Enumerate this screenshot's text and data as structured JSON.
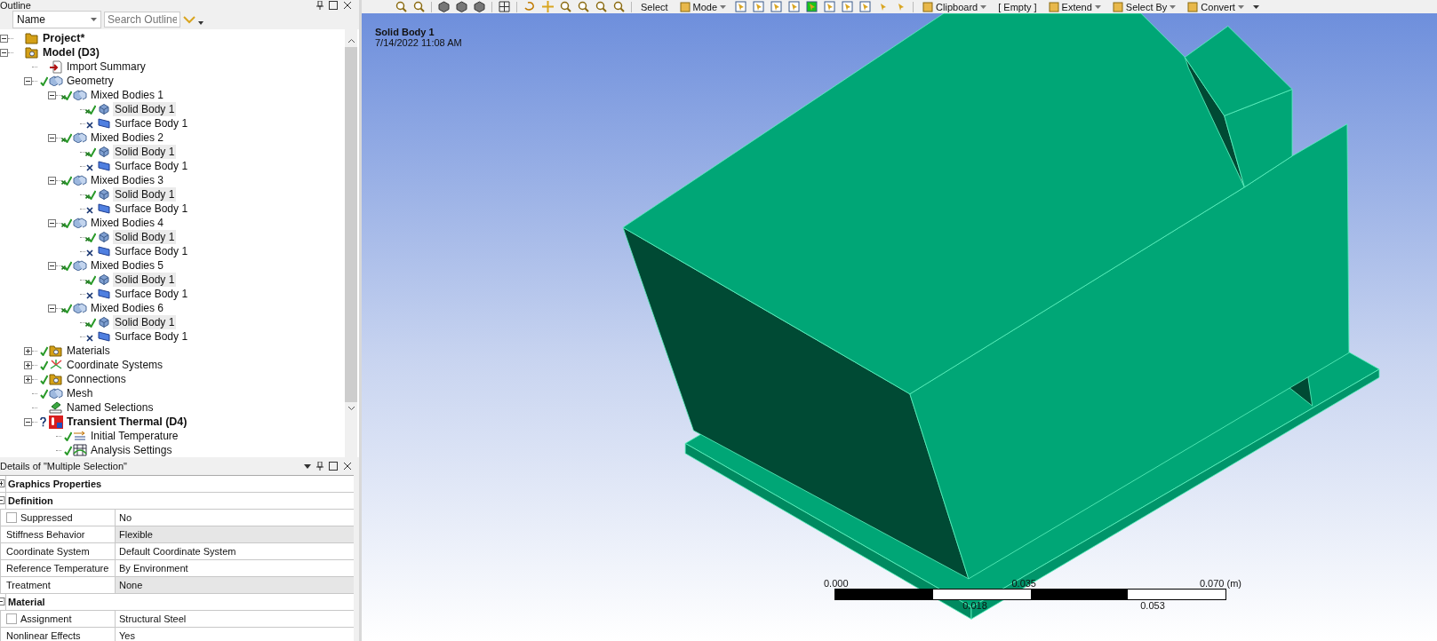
{
  "outline": {
    "title": "Outline",
    "sort_field": "Name",
    "search_placeholder": "Search Outline",
    "tree": [
      {
        "label": "Project*",
        "kind": "project",
        "selected": false,
        "expanded": true,
        "children": [
          {
            "label": "Model (D3)",
            "kind": "model",
            "selected": false,
            "expanded": true,
            "children": [
              {
                "label": "Import Summary",
                "kind": "import",
                "selected": false
              },
              {
                "label": "Geometry",
                "kind": "geometry",
                "selected": false,
                "ok": true,
                "partly_suppressed": false,
                "suppressed": false,
                "undefined": false,
                "expanded": true,
                "children": [
                  {
                    "label": "Mixed Bodies 1",
                    "kind": "bodies",
                    "selected": false,
                    "ok": true,
                    "partly_suppressed": true,
                    "suppressed": false,
                    "undefined": false,
                    "expanded": true,
                    "children": [
                      {
                        "label": "Solid Body 1",
                        "kind": "solid",
                        "selected": true,
                        "ok": true,
                        "partly_suppressed": true,
                        "suppressed": false,
                        "undefined": false
                      },
                      {
                        "label": "Surface Body 1",
                        "kind": "surface",
                        "selected": false,
                        "ok": false,
                        "partly_suppressed": false,
                        "suppressed": true,
                        "undefined": false
                      }
                    ]
                  },
                  {
                    "label": "Mixed Bodies 2",
                    "kind": "bodies",
                    "selected": false,
                    "ok": true,
                    "partly_suppressed": true,
                    "suppressed": false,
                    "undefined": false,
                    "expanded": true,
                    "children": [
                      {
                        "label": "Solid Body 1",
                        "kind": "solid",
                        "selected": true,
                        "ok": true,
                        "partly_suppressed": true,
                        "suppressed": false,
                        "undefined": false
                      },
                      {
                        "label": "Surface Body 1",
                        "kind": "surface",
                        "selected": false,
                        "ok": false,
                        "partly_suppressed": false,
                        "suppressed": true,
                        "undefined": false
                      }
                    ]
                  },
                  {
                    "label": "Mixed Bodies 3",
                    "kind": "bodies",
                    "selected": false,
                    "ok": true,
                    "partly_suppressed": true,
                    "suppressed": false,
                    "undefined": false,
                    "expanded": true,
                    "children": [
                      {
                        "label": "Solid Body 1",
                        "kind": "solid",
                        "selected": true,
                        "ok": true,
                        "partly_suppressed": true,
                        "suppressed": false,
                        "undefined": false
                      },
                      {
                        "label": "Surface Body 1",
                        "kind": "surface",
                        "selected": false,
                        "ok": false,
                        "partly_suppressed": false,
                        "suppressed": true,
                        "undefined": false
                      }
                    ]
                  },
                  {
                    "label": "Mixed Bodies 4",
                    "kind": "bodies",
                    "selected": false,
                    "ok": true,
                    "partly_suppressed": true,
                    "suppressed": false,
                    "undefined": false,
                    "expanded": true,
                    "children": [
                      {
                        "label": "Solid Body 1",
                        "kind": "solid",
                        "selected": true,
                        "ok": true,
                        "partly_suppressed": true,
                        "suppressed": false,
                        "undefined": false
                      },
                      {
                        "label": "Surface Body 1",
                        "kind": "surface",
                        "selected": false,
                        "ok": false,
                        "partly_suppressed": false,
                        "suppressed": true,
                        "undefined": false
                      }
                    ]
                  },
                  {
                    "label": "Mixed Bodies 5",
                    "kind": "bodies",
                    "selected": false,
                    "ok": true,
                    "partly_suppressed": true,
                    "suppressed": false,
                    "undefined": false,
                    "expanded": true,
                    "children": [
                      {
                        "label": "Solid Body 1",
                        "kind": "solid",
                        "selected": true,
                        "ok": true,
                        "partly_suppressed": true,
                        "suppressed": false,
                        "undefined": false
                      },
                      {
                        "label": "Surface Body 1",
                        "kind": "surface",
                        "selected": false,
                        "ok": false,
                        "partly_suppressed": false,
                        "suppressed": true,
                        "undefined": false
                      }
                    ]
                  },
                  {
                    "label": "Mixed Bodies 6",
                    "kind": "bodies",
                    "selected": false,
                    "ok": true,
                    "partly_suppressed": true,
                    "suppressed": false,
                    "undefined": false,
                    "expanded": true,
                    "children": [
                      {
                        "label": "Solid Body 1",
                        "kind": "solid",
                        "selected": true,
                        "ok": true,
                        "partly_suppressed": true,
                        "suppressed": false,
                        "undefined": false
                      },
                      {
                        "label": "Surface Body 1",
                        "kind": "surface",
                        "selected": false,
                        "ok": false,
                        "partly_suppressed": false,
                        "suppressed": true,
                        "undefined": false
                      }
                    ]
                  }
                ]
              },
              {
                "label": "Materials",
                "kind": "materials",
                "selected": false,
                "ok": true,
                "partly_suppressed": false,
                "suppressed": false,
                "undefined": false,
                "expanded": false
              },
              {
                "label": "Coordinate Systems",
                "kind": "coords",
                "selected": false,
                "ok": true,
                "partly_suppressed": false,
                "suppressed": false,
                "undefined": false,
                "expanded": false
              },
              {
                "label": "Connections",
                "kind": "connections",
                "selected": false,
                "ok": true,
                "partly_suppressed": false,
                "suppressed": false,
                "undefined": false,
                "expanded": false
              },
              {
                "label": "Mesh",
                "kind": "mesh",
                "selected": false,
                "ok": true,
                "partly_suppressed": false,
                "suppressed": false,
                "undefined": false
              },
              {
                "label": "Named Selections",
                "kind": "named",
                "selected": false
              },
              {
                "label": "Transient Thermal (D4)",
                "kind": "analysis",
                "selected": false,
                "ok": false,
                "partly_suppressed": false,
                "suppressed": false,
                "undefined": true,
                "expanded": true,
                "children": [
                  {
                    "label": "Initial Temperature",
                    "kind": "init-temp",
                    "selected": false,
                    "ok": true,
                    "partly_suppressed": false,
                    "suppressed": false,
                    "undefined": false
                  },
                  {
                    "label": "Analysis Settings",
                    "kind": "settings",
                    "selected": false,
                    "ok": true,
                    "partly_suppressed": false,
                    "suppressed": false,
                    "undefined": false
                  }
                ]
              }
            ]
          }
        ]
      }
    ]
  },
  "details": {
    "title": "Details of \"Multiple Selection\"",
    "rows": [
      {
        "kind": "section",
        "label": "Graphics Properties",
        "expanded": false
      },
      {
        "kind": "section",
        "label": "Definition",
        "expanded": true
      },
      {
        "kind": "check-prop",
        "label": "Suppressed",
        "value": "No",
        "checked": false,
        "readonly": false
      },
      {
        "kind": "prop",
        "label": "Stiffness Behavior",
        "value": "Flexible",
        "readonly": true
      },
      {
        "kind": "prop",
        "label": "Coordinate System",
        "value": "Default Coordinate System",
        "readonly": false
      },
      {
        "kind": "prop",
        "label": "Reference Temperature",
        "value": "By Environment",
        "readonly": false
      },
      {
        "kind": "prop",
        "label": "Treatment",
        "value": "None",
        "readonly": true
      },
      {
        "kind": "section",
        "label": "Material",
        "expanded": true
      },
      {
        "kind": "check-prop",
        "label": "Assignment",
        "value": "Structural Steel",
        "checked": false,
        "readonly": false
      },
      {
        "kind": "prop",
        "label": "Nonlinear Effects",
        "value": "Yes",
        "readonly": false
      }
    ]
  },
  "toolbar": {
    "items": [
      {
        "label": "Select",
        "kind": "text"
      },
      {
        "label": "Mode",
        "kind": "dropdown"
      },
      {
        "label": "Clipboard",
        "kind": "dropdown"
      },
      {
        "label": "[ Empty ]",
        "kind": "text"
      },
      {
        "label": "Extend",
        "kind": "dropdown"
      },
      {
        "label": "Select By",
        "kind": "dropdown"
      },
      {
        "label": "Convert",
        "kind": "dropdown"
      }
    ]
  },
  "viewport": {
    "title": "Solid Body 1",
    "timestamp": "7/14/2022 11:08 AM",
    "scale": {
      "top_labels": [
        "0.000",
        "0.035",
        "0.070 (m)"
      ],
      "bottom_labels": [
        "0.018",
        "0.053"
      ]
    }
  }
}
